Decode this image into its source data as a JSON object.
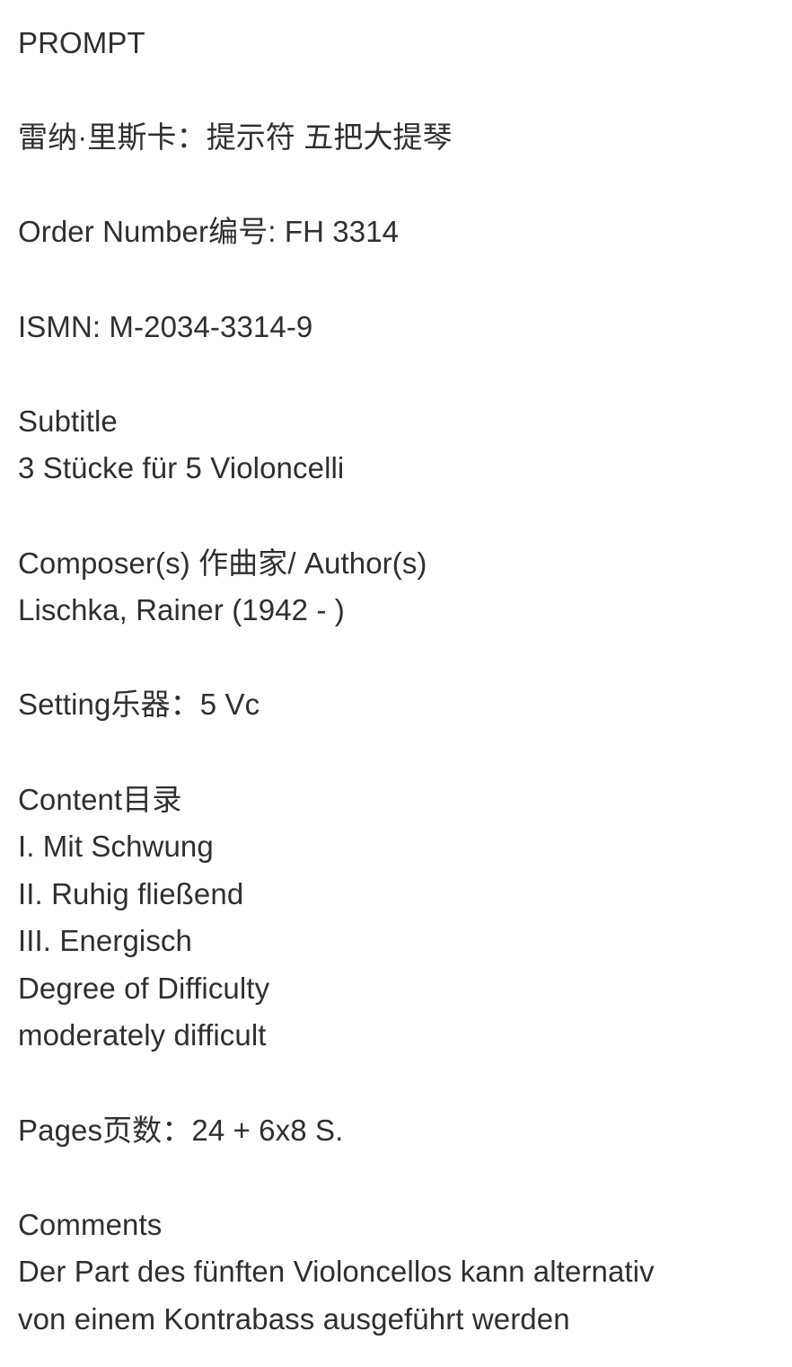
{
  "document": {
    "heading": "PROMPT",
    "title_zh": "雷纳·里斯卡：提示符 五把大提琴",
    "order_number": "Order Number编号: FH 3314",
    "ismn": "ISMN: M-2034-3314-9",
    "subtitle": {
      "label": "Subtitle",
      "value": "3 Stücke für 5 Violoncelli"
    },
    "composer": {
      "label": "Composer(s) 作曲家/ Author(s)",
      "value": "Lischka, Rainer (1942 - )"
    },
    "setting": "Setting乐器：5 Vc",
    "content": {
      "label": "Content目录",
      "items": [
        "I. Mit Schwung",
        "II. Ruhig fließend",
        "III. Energisch"
      ]
    },
    "difficulty": {
      "label": "Degree of Difficulty",
      "value": "moderately difficult"
    },
    "pages": "Pages页数：24 + 6x8 S.",
    "comments": {
      "label": "Comments",
      "lines": [
        "Der Part des fünften Violoncellos kann alternativ",
        "von einem Kontrabass ausgeführt werden"
      ]
    }
  }
}
